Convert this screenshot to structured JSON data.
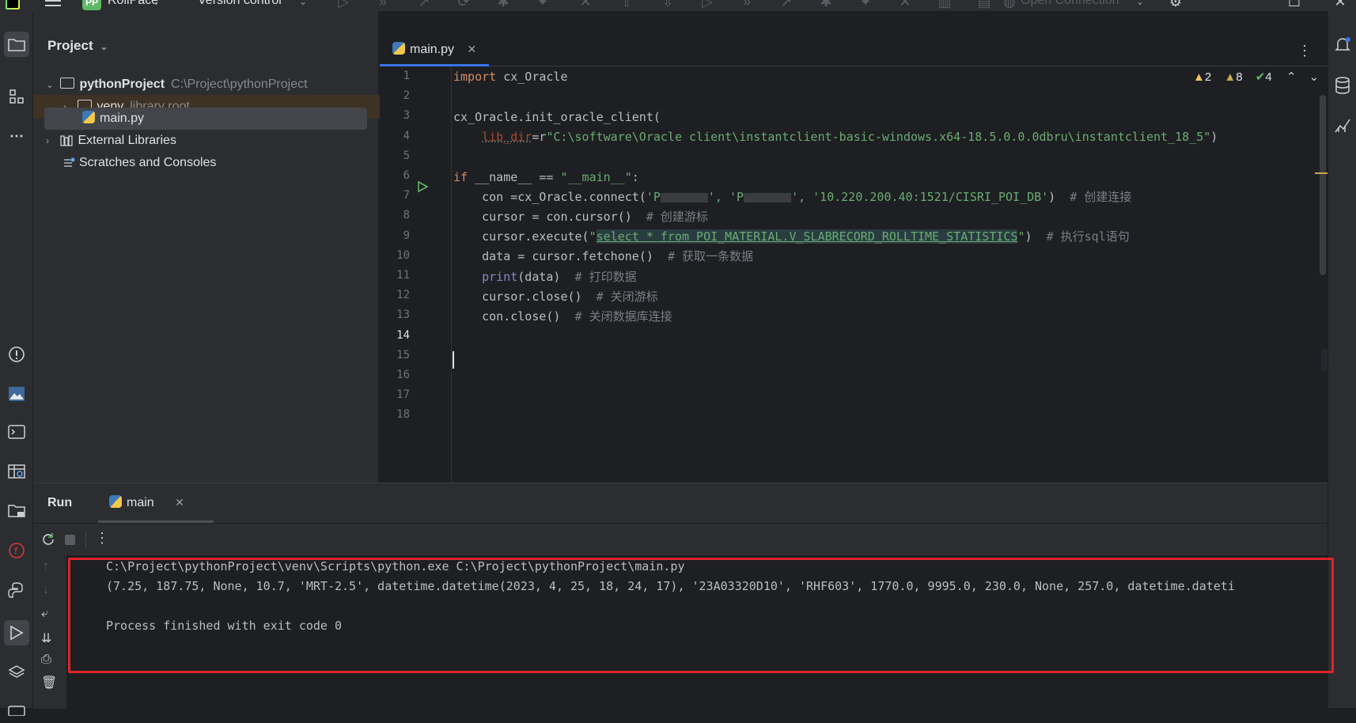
{
  "topbar": {
    "project_badge": "PP",
    "project_name": "RollPace",
    "vcs_label": "Version control",
    "connection_label": "Open Connection"
  },
  "project_panel": {
    "title": "Project",
    "root": {
      "name": "pythonProject",
      "path": "C:\\Project\\pythonProject"
    },
    "venv": {
      "name": "venv",
      "hint": "library root"
    },
    "file": "main.py",
    "external": "External Libraries",
    "scratches": "Scratches and Consoles"
  },
  "editor": {
    "tab_label": "main.py",
    "inspections": {
      "warnings": "2",
      "weak_warnings": "8",
      "ok": "4"
    },
    "line_numbers": [
      "1",
      "2",
      "3",
      "4",
      "5",
      "6",
      "7",
      "8",
      "9",
      "10",
      "11",
      "12",
      "13",
      "14",
      "15",
      "16",
      "17",
      "18"
    ],
    "current_line": "14",
    "code": {
      "l1_kw": "import",
      "l1_rest": " cx_Oracle",
      "l3": "cx_Oracle.init_oracle_client(",
      "l4_param": "lib_dir",
      "l4_eq": "=r",
      "l4_str": "\"C:\\software\\Oracle client\\instantclient-basic-windows.x64-18.5.0.0.0dbru\\instantclient_18_5\"",
      "l4_close": ")",
      "l6_kw": "if",
      "l6_rest": " __name__ == ",
      "l6_str": "\"__main__\"",
      "l6_colon": ":",
      "l7_a": "con =cx_Oracle.connect(",
      "l7_s1": "'P",
      "l7_s2": "'P",
      "l7_s3": "'10.220.200.40:1521/CISRI_POI_DB'",
      "l7_b": ")",
      "l7_cm": "# 创建连接",
      "l8_a": "cursor = con.cursor()",
      "l8_cm": "# 创建游标",
      "l9_a": "cursor.execute(",
      "l9_q1": "\"",
      "l9_sql": "select * from POI_MATERIAL.V_SLABRECORD_ROLLTIME_STATISTICS",
      "l9_q2": "\"",
      "l9_b": ")",
      "l9_cm": "# 执行sql语句",
      "l10_a": "data = cursor.fetchone()",
      "l10_cm": "# 获取一条数据",
      "l11_bi": "print",
      "l11_a": "(data)",
      "l11_cm": "# 打印数据",
      "l12_a": "cursor.close()",
      "l12_cm": "# 关闭游标",
      "l13_a": "con.close()",
      "l13_cm": "# 关闭数据库连接"
    }
  },
  "run_panel": {
    "title": "Run",
    "tab_label": "main",
    "console": [
      "C:\\Project\\pythonProject\\venv\\Scripts\\python.exe C:\\Project\\pythonProject\\main.py",
      "(7.25, 187.75, None, 10.7, 'MRT-2.5', datetime.datetime(2023, 4, 25, 18, 24, 17), '23A03320D10', 'RHF603', 1770.0, 9995.0, 230.0, None, 257.0, datetime.dateti",
      "",
      "Process finished with exit code 0"
    ]
  },
  "colors": {
    "highlight_box": "#e0232a",
    "accent": "#3574f0"
  }
}
